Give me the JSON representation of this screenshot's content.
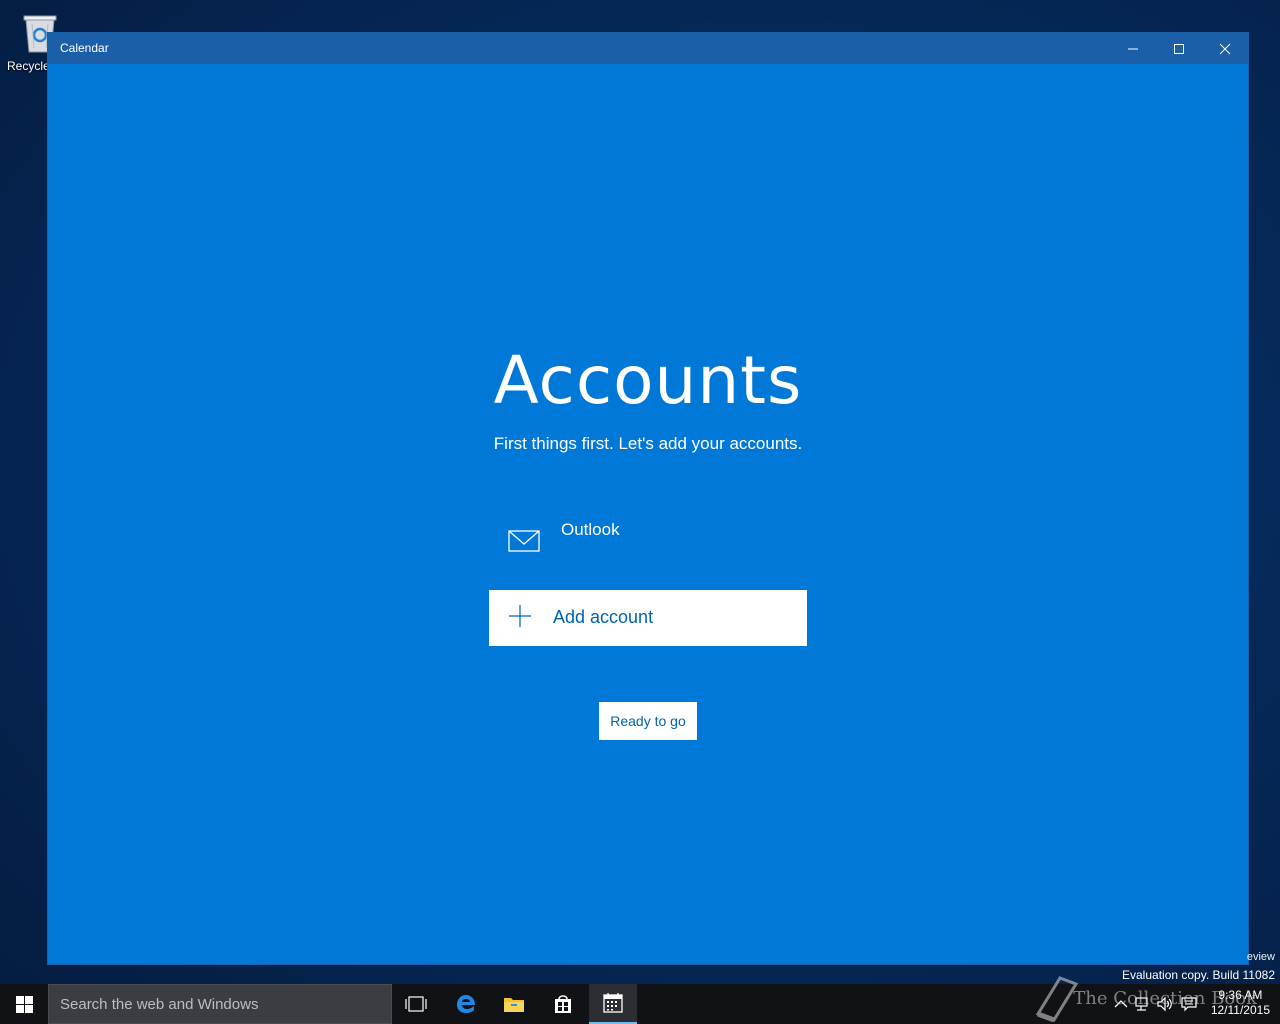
{
  "desktop": {
    "recycle_label": "Recycle"
  },
  "window": {
    "title": "Calendar",
    "heading": "Accounts",
    "subtitle": "First things first. Let's add your accounts.",
    "accounts": [
      {
        "name": "Outlook",
        "icon": "mail-icon"
      }
    ],
    "add_account_label": "Add account",
    "ready_label": "Ready to go",
    "accent": "#0078d7"
  },
  "overlay": {
    "review_text": "eview",
    "evaluation_text": "Evaluation copy. Build 11082",
    "watermark": "The Collection Book"
  },
  "taskbar": {
    "search_placeholder": "Search the web and Windows",
    "time": "9:36 AM",
    "date": "12/11/2015"
  }
}
